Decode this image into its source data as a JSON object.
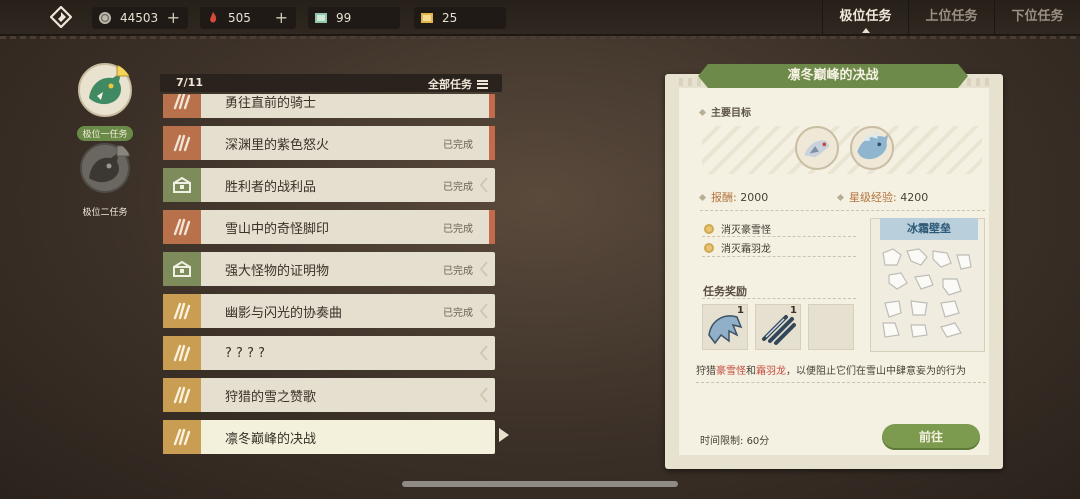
{
  "resources": [
    {
      "icon": "coin-icon",
      "value": "44503",
      "has_plus": true
    },
    {
      "icon": "flame-gem-icon",
      "value": "505",
      "has_plus": true
    },
    {
      "icon": "green-ticket-icon",
      "value": "99",
      "has_plus": false
    },
    {
      "icon": "gold-ticket-icon",
      "value": "25",
      "has_plus": false
    }
  ],
  "tabs": [
    "极位任务",
    "上位任务",
    "下位任务"
  ],
  "active_tab": 0,
  "ranks": [
    {
      "label": "极位一任务",
      "active": true
    },
    {
      "label": "极位二任务",
      "active": false
    }
  ],
  "list": {
    "progress": "7/11",
    "all_label": "全部任务",
    "quests": [
      {
        "name": "勇往直前的骑士",
        "status": "",
        "icon_color": "red"
      },
      {
        "name": "深渊里的紫色怒火",
        "status": "已完成",
        "icon_color": "red"
      },
      {
        "name": "胜利者的战利品",
        "status": "已完成",
        "icon_color": "green"
      },
      {
        "name": "雪山中的奇怪脚印",
        "status": "已完成",
        "icon_color": "red"
      },
      {
        "name": "强大怪物的证明物",
        "status": "已完成",
        "icon_color": "green"
      },
      {
        "name": "幽影与闪光的协奏曲",
        "status": "已完成",
        "icon_color": "gold"
      },
      {
        "name": "? ? ? ?",
        "status": "",
        "icon_color": "gold"
      },
      {
        "name": "狩猎的雪之赞歌",
        "status": "",
        "icon_color": "gold"
      },
      {
        "name": "凛冬巅峰的决战",
        "status": "",
        "icon_color": "gold"
      }
    ],
    "selected": 8
  },
  "detail": {
    "title": "凛冬巅峰的决战",
    "main_target_label": "主要目标",
    "reward_label": "报酬:",
    "reward_value": "2000",
    "exp_label": "星级经验:",
    "exp_value": "4200",
    "objectives": [
      "消灭豪雪怪",
      "消灭霜羽龙"
    ],
    "map_name": "冰霜壁垒",
    "rewards_title": "任务奖励",
    "reward_items": [
      {
        "icon": "fang-material-icon",
        "qty": "1"
      },
      {
        "icon": "claw-material-icon",
        "qty": "1"
      },
      {
        "icon": "",
        "qty": ""
      }
    ],
    "desc_prefix": "狩猎",
    "desc_m1": "豪雪怪",
    "desc_and": "和",
    "desc_m2": "霜羽龙",
    "desc_suffix": "，以便阻止它们在雪山中肆意妄为的行为",
    "time_label": "时间限制:",
    "time_value": "60分",
    "go_label": "前往"
  },
  "colors": {
    "accent_green": "#6e8a4a",
    "highlight_red": "#c2493c"
  }
}
